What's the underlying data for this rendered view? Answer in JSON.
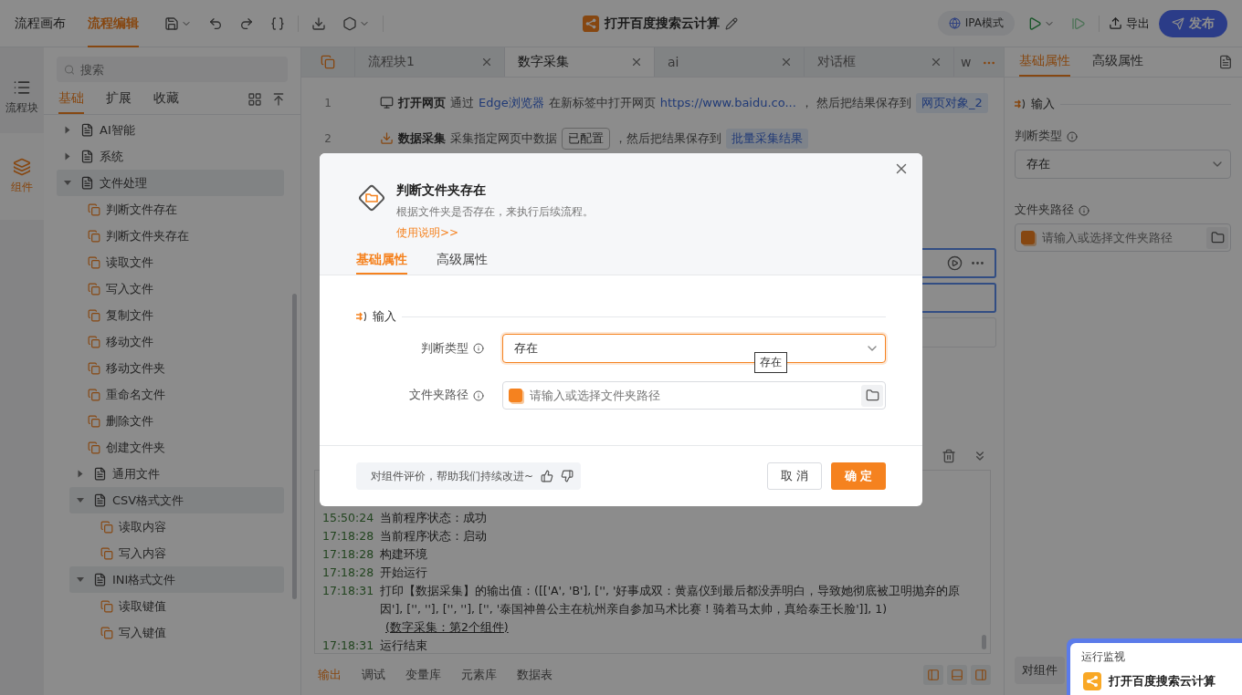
{
  "topbar": {
    "tabs": [
      {
        "label": "流程画布",
        "selected": false
      },
      {
        "label": "流程编辑",
        "selected": true
      }
    ],
    "title": "打开百度搜索云计算",
    "mode": "IPA模式",
    "export": "导出",
    "publish": "发布"
  },
  "rail": [
    {
      "label": "流程块",
      "selected": false
    },
    {
      "label": "组件",
      "selected": true
    }
  ],
  "library": {
    "search_placeholder": "搜索",
    "tabs": [
      {
        "label": "基础",
        "selected": true
      },
      {
        "label": "扩展",
        "selected": false
      },
      {
        "label": "收藏",
        "selected": false
      }
    ],
    "tree": [
      {
        "kind": "group",
        "label": "AI智能",
        "expanded": false
      },
      {
        "kind": "group",
        "label": "系统",
        "expanded": false
      },
      {
        "kind": "group",
        "label": "文件处理",
        "expanded": true,
        "children": [
          {
            "kind": "item",
            "label": "判断文件存在"
          },
          {
            "kind": "item",
            "label": "判断文件夹存在"
          },
          {
            "kind": "item",
            "label": "读取文件"
          },
          {
            "kind": "item",
            "label": "写入文件"
          },
          {
            "kind": "item",
            "label": "复制文件"
          },
          {
            "kind": "item",
            "label": "移动文件"
          },
          {
            "kind": "item",
            "label": "移动文件夹"
          },
          {
            "kind": "item",
            "label": "重命名文件"
          },
          {
            "kind": "item",
            "label": "删除文件"
          },
          {
            "kind": "item",
            "label": "创建文件夹"
          },
          {
            "kind": "group",
            "label": "通用文件",
            "expanded": false
          },
          {
            "kind": "group",
            "label": "CSV格式文件",
            "expanded": true,
            "children": [
              {
                "kind": "item",
                "label": "读取内容"
              },
              {
                "kind": "item",
                "label": "写入内容"
              }
            ]
          },
          {
            "kind": "group",
            "label": "INI格式文件",
            "expanded": true,
            "children": [
              {
                "kind": "item",
                "label": "读取键值"
              },
              {
                "kind": "item",
                "label": "写入键值"
              }
            ]
          }
        ]
      }
    ]
  },
  "editor": {
    "tabs": [
      {
        "label": "流程块1",
        "selected": false
      },
      {
        "label": "数字采集",
        "selected": true
      },
      {
        "label": "ai",
        "selected": false
      },
      {
        "label": "对话框",
        "selected": false
      },
      {
        "label": "w",
        "selected": false
      }
    ],
    "steps": [
      {
        "line": "1",
        "segments": [
          {
            "kind": "title",
            "text": "打开网页"
          },
          {
            "kind": "plain",
            "text": "通过"
          },
          {
            "kind": "link",
            "text": "Edge浏览器"
          },
          {
            "kind": "plain",
            "text": "在新标签中打开网页"
          },
          {
            "kind": "link",
            "text": "https://www.baidu.co..."
          },
          {
            "kind": "plain",
            "text": "，  然后把结果保存到"
          },
          {
            "kind": "var",
            "text": "网页对象_2"
          }
        ]
      },
      {
        "line": "2",
        "segments": [
          {
            "kind": "title",
            "text": "数据采集"
          },
          {
            "kind": "plain",
            "text": "采集指定网页中数据"
          },
          {
            "kind": "tag",
            "text": "已配置"
          },
          {
            "kind": "plain",
            "text": "，然后把结果保存到"
          },
          {
            "kind": "var",
            "text": "批量采集结果"
          }
        ]
      }
    ],
    "hidden_steps": [
      {
        "selected": true,
        "hovered": true
      },
      {
        "selected": true,
        "hovered": false
      },
      {
        "selected": false,
        "hovered": false
      }
    ]
  },
  "log": {
    "lines": [
      {
        "time": "15:50:24",
        "text": "当前程序状态：成功"
      },
      {
        "time": "17:18:28",
        "text": "当前程序状态：启动"
      },
      {
        "time": "17:18:28",
        "text": "构建环境"
      },
      {
        "time": "17:18:28",
        "text": "开始运行"
      },
      {
        "time": "17:18:31",
        "text": "打印【数据采集】的输出值：([['A', 'B'], ['', '好事成双：黄嘉仪到最后都没弄明白，导致她彻底被卫明抛弃的原因'], ['', ''], ['', ''], ['', '泰国神兽公主在杭州亲自参加马术比赛！骑着马太帅，真给泰王长脸']], 1)",
        "link": "(数字采集：第2个组件)"
      },
      {
        "time": "17:18:31",
        "text": "运行结束"
      }
    ],
    "tabs": [
      {
        "label": "输出",
        "selected": true
      },
      {
        "label": "调试",
        "selected": false
      },
      {
        "label": "变量库",
        "selected": false
      },
      {
        "label": "元素库",
        "selected": false
      },
      {
        "label": "数据表",
        "selected": false
      }
    ]
  },
  "properties": {
    "tabs": [
      {
        "label": "基础属性",
        "selected": true
      },
      {
        "label": "高级属性",
        "selected": false
      }
    ],
    "section": "输入",
    "fields": [
      {
        "kind": "select",
        "label": "判断类型",
        "value": "存在"
      },
      {
        "kind": "path",
        "label": "文件夹路径",
        "placeholder": "请输入或选择文件夹路径"
      }
    ],
    "feedback": "对组件"
  },
  "monitor": {
    "tab": "运行监视",
    "title": "打开百度搜索云计算"
  },
  "dialog": {
    "title": "判断文件夹存在",
    "description": "根据文件夹是否存在，来执行后续流程。",
    "help_link": "使用说明>>",
    "tabs": [
      {
        "label": "基础属性",
        "selected": true
      },
      {
        "label": "高级属性",
        "selected": false
      }
    ],
    "section": "输入",
    "fields": [
      {
        "kind": "select",
        "label": "判断类型",
        "value": "存在",
        "focused": true,
        "tooltip": "存在"
      },
      {
        "kind": "path",
        "label": "文件夹路径",
        "placeholder": "请输入或选择文件夹路径",
        "focused": false
      }
    ],
    "feedback": "对组件评价，帮助我们持续改进~",
    "buttons": [
      {
        "kind": "secondary",
        "label": "取 消"
      },
      {
        "kind": "primary",
        "label": "确 定"
      }
    ]
  }
}
